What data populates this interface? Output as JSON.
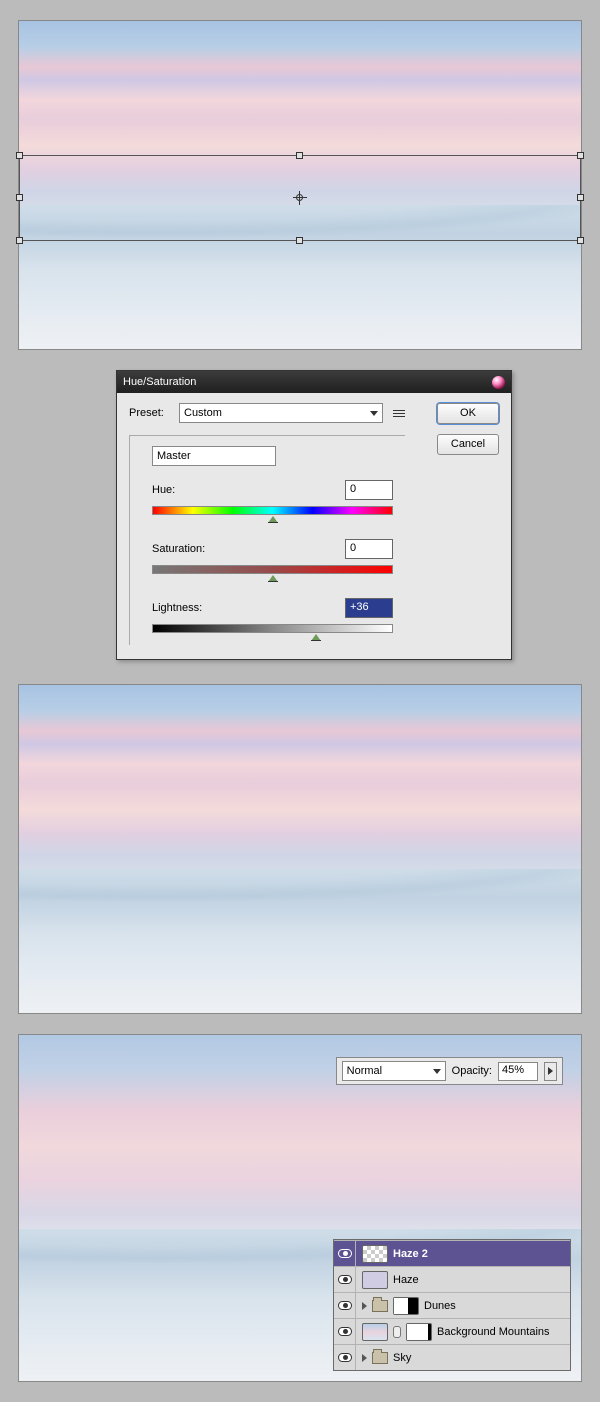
{
  "dialog": {
    "title": "Hue/Saturation",
    "preset_label": "Preset:",
    "preset_value": "Custom",
    "ok": "OK",
    "cancel": "Cancel",
    "channel": "Master",
    "hue_label": "Hue:",
    "hue_value": "0",
    "sat_label": "Saturation:",
    "sat_value": "0",
    "lit_label": "Lightness:",
    "lit_value": "+36"
  },
  "overlay": {
    "blend_mode": "Normal",
    "opacity_label": "Opacity:",
    "opacity_value": "45%"
  },
  "layers": [
    {
      "name": "Haze 2",
      "selected": true,
      "thumb": "checker",
      "group": false
    },
    {
      "name": "Haze",
      "selected": false,
      "thumb": "haze",
      "group": false
    },
    {
      "name": "Dunes",
      "selected": false,
      "group": true,
      "mask": "half"
    },
    {
      "name": "Background Mountains",
      "selected": false,
      "group": false,
      "thumb": "sky",
      "mask": "mostly",
      "linked": true
    },
    {
      "name": "Sky",
      "selected": false,
      "group": true
    }
  ]
}
